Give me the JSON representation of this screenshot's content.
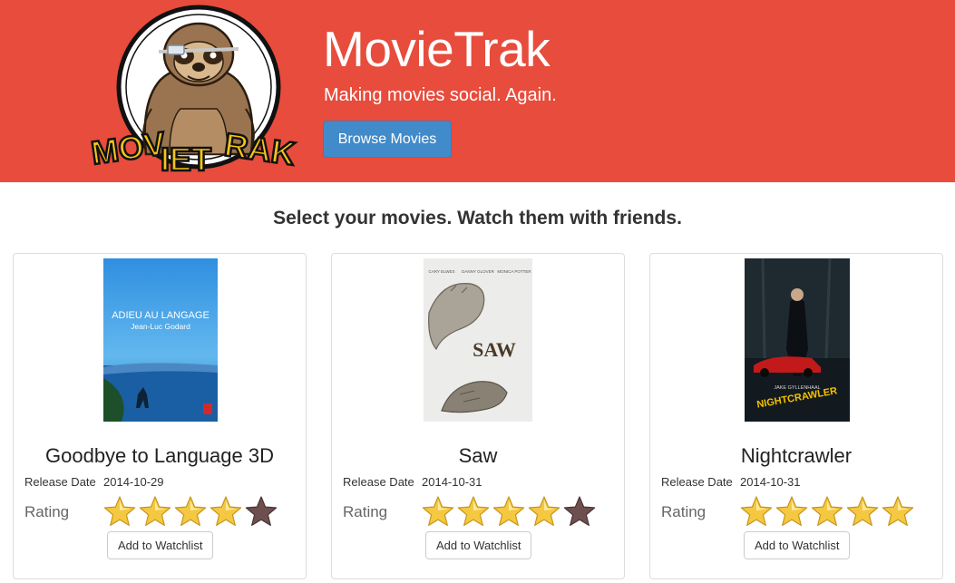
{
  "header": {
    "title": "MovieTrak",
    "tagline": "Making movies social. Again.",
    "browse_label": "Browse Movies",
    "logo_text": "MOVIETRAK",
    "background_color": "#e74c3c",
    "button_color": "#428bca"
  },
  "lead": "Select your movies. Watch them with friends.",
  "labels": {
    "release_date": "Release Date",
    "rating": "Rating",
    "watchlist": "Add to Watchlist"
  },
  "movies": [
    {
      "title": "Goodbye to Language 3D",
      "release_date": "2014-10-29",
      "rating": 4,
      "max_rating": 5,
      "poster": {
        "title": "ADIEU AU LANGAGE",
        "subtitle": "Jean-Luc Godard"
      }
    },
    {
      "title": "Saw",
      "release_date": "2014-10-31",
      "rating": 4,
      "max_rating": 5,
      "poster": {
        "title": "SAW",
        "cast": [
          "CARY ELWES",
          "DANNY GLOVER",
          "MONICA POTTER"
        ]
      }
    },
    {
      "title": "Nightcrawler",
      "release_date": "2014-10-31",
      "rating": 5,
      "max_rating": 5,
      "poster": {
        "title": "NIGHTCRAWLER",
        "actor": "JAKE GYLLENHAAL"
      }
    }
  ]
}
